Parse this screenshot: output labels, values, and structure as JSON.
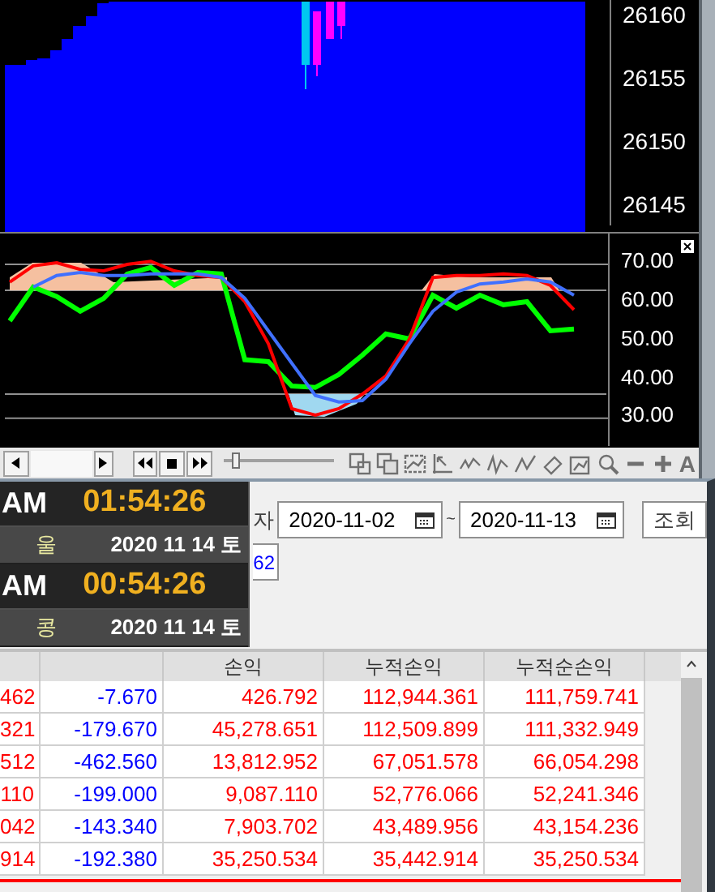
{
  "price_axis": {
    "labels": [
      "26160",
      "26155",
      "26150",
      "26145"
    ]
  },
  "indicator": {
    "chart_data": {
      "type": "line",
      "ylim": [
        22.8,
        78
      ],
      "yticks": [
        {
          "value": 70,
          "label": "70.00"
        },
        {
          "value": 60,
          "label": "60.00"
        },
        {
          "value": 50,
          "label": "50.00"
        },
        {
          "value": 40,
          "label": "40.00"
        },
        {
          "value": 30,
          "label": "30.00"
        }
      ],
      "series": [
        {
          "color": "#4070ff",
          "values": [
            null,
            64.1,
            67.1,
            67.9,
            67.1,
            67.1,
            67.5,
            67.5,
            67.5,
            66.6,
            61.2,
            52.7,
            44.3,
            35.9,
            34.2,
            34.6,
            40.1,
            49.4,
            57.8,
            62.8,
            64.9,
            65.4,
            66.2,
            65.4,
            62.0
          ]
        },
        {
          "color": "#ff0000",
          "values": [
            65.4,
            69.6,
            70.4,
            68.7,
            68.3,
            70.0,
            70.8,
            68.3,
            67.1,
            66.6,
            60.3,
            49.4,
            32.5,
            30.8,
            32.5,
            36.3,
            41.0,
            50.6,
            66.6,
            67.1,
            67.1,
            67.5,
            67.1,
            64.5,
            58.2
          ]
        },
        {
          "color": "#00ff00",
          "values": [
            55.3,
            64.1,
            61.6,
            57.8,
            61.2,
            67.5,
            69.2,
            64.5,
            67.9,
            67.5,
            45.2,
            44.7,
            38.4,
            38.0,
            41.4,
            46.4,
            51.9,
            50.6,
            62.0,
            58.6,
            62.0,
            59.5,
            60.3,
            52.7,
            53.2
          ]
        }
      ]
    }
  },
  "toolbar": {
    "zoom_slider": {
      "level": 0.08
    },
    "text_tool": "A"
  },
  "clocks": [
    {
      "period": "AM",
      "time": "01:54:26",
      "city": "울",
      "date": "2020 11 14 토"
    },
    {
      "period": "AM",
      "time": "00:54:26",
      "city": "콩",
      "date": "2020 11 14 토"
    }
  ],
  "query": {
    "label": "자",
    "start_date": "2020-11-02",
    "separator": "~",
    "end_date": "2020-11-13",
    "button": "조회",
    "account_fragment": "62"
  },
  "table": {
    "headers": {
      "column_3": "손익",
      "column_4": "누적손익",
      "column_5": "누적순손익"
    },
    "rows": [
      [
        "462",
        "-7.670",
        "426.792",
        "112,944.361",
        "111,759.741"
      ],
      [
        "321",
        "-179.670",
        "45,278.651",
        "112,509.899",
        "111,332.949"
      ],
      [
        "512",
        "-462.560",
        "13,812.952",
        "67,051.578",
        "66,054.298"
      ],
      [
        "110",
        "-199.000",
        "9,087.110",
        "52,776.066",
        "52,241.346"
      ],
      [
        "042",
        "-143.340",
        "7,903.702",
        "43,489.956",
        "43,154.236"
      ],
      [
        "914",
        "-192.380",
        "35,250.534",
        "35,442.914",
        "35,250.534"
      ]
    ]
  }
}
